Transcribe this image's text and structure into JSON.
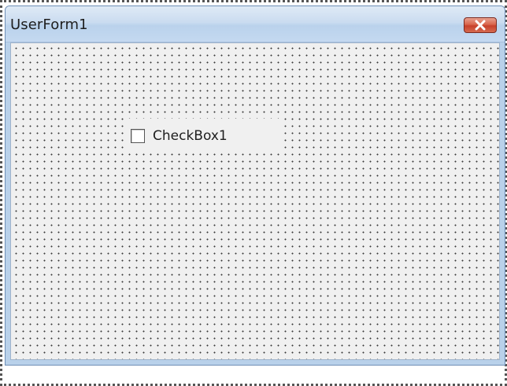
{
  "window": {
    "title": "UserForm1",
    "close_icon": "close-icon",
    "close_button_color": "#c7402a"
  },
  "form": {
    "grid_dot_color": "#3a3a3a",
    "background_color": "#f0f0f0",
    "controls": {
      "checkbox1": {
        "label": "CheckBox1",
        "checked": false
      }
    }
  }
}
